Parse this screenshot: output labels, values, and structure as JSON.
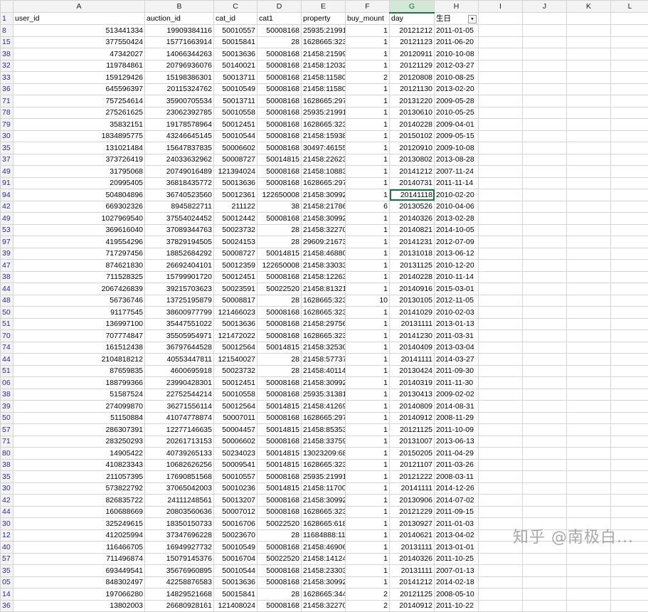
{
  "columns": [
    "",
    "A",
    "B",
    "C",
    "D",
    "E",
    "F",
    "G",
    "H",
    "I",
    "J",
    "K",
    "L"
  ],
  "selected_column": "G",
  "header_row": {
    "row_label": "1",
    "cells": [
      "user_id",
      "auction_id",
      "cat_id",
      "cat1",
      "property",
      "buy_mount",
      "day",
      "生日"
    ]
  },
  "rows": [
    {
      "row": "8",
      "cells": [
        "513441334",
        "19909384116",
        "50010557",
        "50008168",
        "25935:21991",
        "1",
        "20121212",
        "2011-01-05"
      ]
    },
    {
      "row": "15",
      "cells": [
        "377550424",
        "15771663914",
        "50015841",
        "28",
        "1628665:323",
        "1",
        "20121123",
        "2011-06-20"
      ]
    },
    {
      "row": "38",
      "cells": [
        "47342027",
        "14066344263",
        "50013636",
        "50008168",
        "21458:21599",
        "1",
        "20120911",
        "2010-10-08"
      ]
    },
    {
      "row": "32",
      "cells": [
        "119784861",
        "20796936076",
        "50140021",
        "50008168",
        "21458:12032",
        "1",
        "20121129",
        "2012-03-27"
      ]
    },
    {
      "row": "33",
      "cells": [
        "159129426",
        "15198386301",
        "50013711",
        "50008168",
        "21458:11580",
        "2",
        "20120808",
        "2010-08-25"
      ]
    },
    {
      "row": "36",
      "cells": [
        "645596397",
        "20115324762",
        "50010549",
        "50008168",
        "21458:11580",
        "1",
        "20121130",
        "2013-02-20"
      ]
    },
    {
      "row": "71",
      "cells": [
        "757254614",
        "35900705534",
        "50013711",
        "50008168",
        "1628665:297",
        "1",
        "20131220",
        "2009-05-28"
      ]
    },
    {
      "row": "78",
      "cells": [
        "275261625",
        "23062392785",
        "50010558",
        "50008168",
        "25935:21991",
        "1",
        "20130610",
        "2010-05-25"
      ]
    },
    {
      "row": "79",
      "cells": [
        "35832151",
        "19178578964",
        "50012451",
        "50008168",
        "1628665:323",
        "1",
        "20140228",
        "2009-04-01"
      ]
    },
    {
      "row": "30",
      "cells": [
        "1834895775",
        "43246645145",
        "50010544",
        "50008168",
        "21458:15938",
        "1",
        "20150102",
        "2009-05-15"
      ]
    },
    {
      "row": "35",
      "cells": [
        "131021484",
        "15647837835",
        "50006602",
        "50008168",
        "30497:46155",
        "1",
        "20120910",
        "2009-10-08"
      ]
    },
    {
      "row": "37",
      "cells": [
        "373726419",
        "24033632962",
        "50008727",
        "50014815",
        "21458:22623",
        "1",
        "20130802",
        "2013-08-28"
      ]
    },
    {
      "row": "49",
      "cells": [
        "31795068",
        "20749016489",
        "121394024",
        "50008168",
        "21458:10883",
        "1",
        "20141212",
        "2007-11-24"
      ]
    },
    {
      "row": "91",
      "cells": [
        "20995405",
        "36818435772",
        "50013636",
        "50008168",
        "1628665:297",
        "1",
        "20140731",
        "2011-11-14"
      ]
    },
    {
      "row": "94",
      "cells": [
        "504804896",
        "36740523560",
        "50012361",
        "122650008",
        "21458:30992",
        "1",
        "20141118",
        "2010-02-20"
      ]
    },
    {
      "row": "42",
      "cells": [
        "669302326",
        "8945822711",
        "211122",
        "38",
        "21458:21786",
        "6",
        "20130526",
        "2010-04-06"
      ]
    },
    {
      "row": "49",
      "cells": [
        "1027969540",
        "37554024452",
        "50012442",
        "50008168",
        "21458:30992",
        "1",
        "20140326",
        "2013-02-28"
      ]
    },
    {
      "row": "53",
      "cells": [
        "369616040",
        "37089344763",
        "50023732",
        "28",
        "21458:32270",
        "1",
        "20140821",
        "2014-10-05"
      ]
    },
    {
      "row": "97",
      "cells": [
        "419554296",
        "37829194505",
        "50024153",
        "28",
        "29609:21673",
        "1",
        "20141231",
        "2012-07-09"
      ]
    },
    {
      "row": "39",
      "cells": [
        "717297456",
        "18852684292",
        "50008727",
        "50014815",
        "21458:46880",
        "1",
        "20131018",
        "2013-06-12"
      ]
    },
    {
      "row": "47",
      "cells": [
        "874621830",
        "26692404101",
        "50012359",
        "122650008",
        "21458:33033",
        "1",
        "20131125",
        "2010-12-20"
      ]
    },
    {
      "row": "38",
      "cells": [
        "711528325",
        "15799901720",
        "50012451",
        "50008168",
        "21458:12263",
        "1",
        "20140228",
        "2010-11-14"
      ]
    },
    {
      "row": "44",
      "cells": [
        "2067426839",
        "39215703623",
        "50023591",
        "50022520",
        "21458:81321",
        "1",
        "20140916",
        "2015-03-01"
      ]
    },
    {
      "row": "48",
      "cells": [
        "56736746",
        "13725195879",
        "50008817",
        "28",
        "1628665:323",
        "10",
        "20130105",
        "2012-11-05"
      ]
    },
    {
      "row": "50",
      "cells": [
        "91177545",
        "38600977799",
        "121466023",
        "50008168",
        "1628665:323",
        "1",
        "20141029",
        "2010-02-03"
      ]
    },
    {
      "row": "51",
      "cells": [
        "136997100",
        "35447551022",
        "50013636",
        "50008168",
        "21458:29756",
        "1",
        "20131111",
        "2013-01-13"
      ]
    },
    {
      "row": "70",
      "cells": [
        "707774847",
        "35505954971",
        "121472022",
        "50008168",
        "1628665:323",
        "1",
        "20141230",
        "2011-03-31"
      ]
    },
    {
      "row": "74",
      "cells": [
        "161512438",
        "36797644528",
        "50012564",
        "50014815",
        "21458:32530",
        "1",
        "20140409",
        "2013-03-04"
      ]
    },
    {
      "row": "44",
      "cells": [
        "2104818212",
        "40553447811",
        "121540027",
        "28",
        "21458:57737",
        "1",
        "20141111",
        "2014-03-27"
      ]
    },
    {
      "row": "51",
      "cells": [
        "87659835",
        "4600695918",
        "50023732",
        "28",
        "21458:40114",
        "1",
        "20130424",
        "2011-09-30"
      ]
    },
    {
      "row": "06",
      "cells": [
        "188799366",
        "23990428301",
        "50012451",
        "50008168",
        "21458:30992",
        "1",
        "20140319",
        "2011-11-30"
      ]
    },
    {
      "row": "38",
      "cells": [
        "51587524",
        "22752544214",
        "50010558",
        "50008168",
        "25935:31381",
        "1",
        "20130413",
        "2009-02-02"
      ]
    },
    {
      "row": "39",
      "cells": [
        "274099870",
        "36271556114",
        "50012564",
        "50014815",
        "21458:41269",
        "1",
        "20140809",
        "2014-08-31"
      ]
    },
    {
      "row": "50",
      "cells": [
        "51150884",
        "41074778874",
        "50007011",
        "50008168",
        "1628665:297",
        "1",
        "20140912",
        "2008-11-29"
      ]
    },
    {
      "row": "57",
      "cells": [
        "286307391",
        "12277146635",
        "50004457",
        "50014815",
        "21458:85353",
        "1",
        "20121125",
        "2011-10-09"
      ]
    },
    {
      "row": "71",
      "cells": [
        "283250293",
        "20261713153",
        "50006602",
        "50008168",
        "21458:33759",
        "1",
        "20131007",
        "2013-06-13"
      ]
    },
    {
      "row": "80",
      "cells": [
        "14905422",
        "40739265133",
        "50234023",
        "50014815",
        "13023209:68",
        "1",
        "20150205",
        "2011-04-29"
      ]
    },
    {
      "row": "38",
      "cells": [
        "410823343",
        "10682626256",
        "50009541",
        "50014815",
        "1628665:323",
        "1",
        "20121107",
        "2011-03-26"
      ]
    },
    {
      "row": "35",
      "cells": [
        "211057395",
        "17690851568",
        "50010557",
        "50008168",
        "25935:21991",
        "1",
        "20121222",
        "2008-03-11"
      ]
    },
    {
      "row": "30",
      "cells": [
        "573822792",
        "37065042003",
        "50010236",
        "50014815",
        "21458:11700",
        "1",
        "20141111",
        "2014-12-26"
      ]
    },
    {
      "row": "42",
      "cells": [
        "826835722",
        "24111248561",
        "50013207",
        "50008168",
        "21458:30992",
        "1",
        "20130906",
        "2014-07-02"
      ]
    },
    {
      "row": "44",
      "cells": [
        "160688669",
        "20803560636",
        "50007012",
        "50008168",
        "1628665:323",
        "1",
        "20121229",
        "2011-09-15"
      ]
    },
    {
      "row": "30",
      "cells": [
        "325249615",
        "18350150733",
        "50016706",
        "50022520",
        "1628665:618",
        "1",
        "20130927",
        "2011-01-03"
      ]
    },
    {
      "row": "12",
      "cells": [
        "412025994",
        "37347696228",
        "50023670",
        "28",
        "11684888:11",
        "1",
        "20140621",
        "2013-04-02"
      ]
    },
    {
      "row": "40",
      "cells": [
        "116466705",
        "16949927732",
        "50010549",
        "50008168",
        "21458:46906",
        "1",
        "20131111",
        "2013-01-01"
      ]
    },
    {
      "row": "57",
      "cells": [
        "711496874",
        "15079145376",
        "50016704",
        "50022520",
        "21458:14124",
        "1",
        "20140326",
        "2011-10-25"
      ]
    },
    {
      "row": "35",
      "cells": [
        "693449541",
        "35676960895",
        "50010544",
        "50008168",
        "21458:23303",
        "1",
        "20131111",
        "2007-01-13"
      ]
    },
    {
      "row": "05",
      "cells": [
        "848302497",
        "42258876583",
        "50013636",
        "50008168",
        "21458:30992",
        "1",
        "20141212",
        "2014-02-18"
      ]
    },
    {
      "row": "14",
      "cells": [
        "197066280",
        "14829521668",
        "50015841",
        "28",
        "1628665:344",
        "2",
        "20121125",
        "2008-05-10"
      ]
    },
    {
      "row": "36",
      "cells": [
        "13802003",
        "26680928161",
        "121408024",
        "50008168",
        "21458:32270",
        "2",
        "20140912",
        "2011-10-22"
      ]
    }
  ],
  "active_cell": {
    "row_index": 14,
    "column": "G"
  },
  "watermark": "知乎 @南极白..."
}
